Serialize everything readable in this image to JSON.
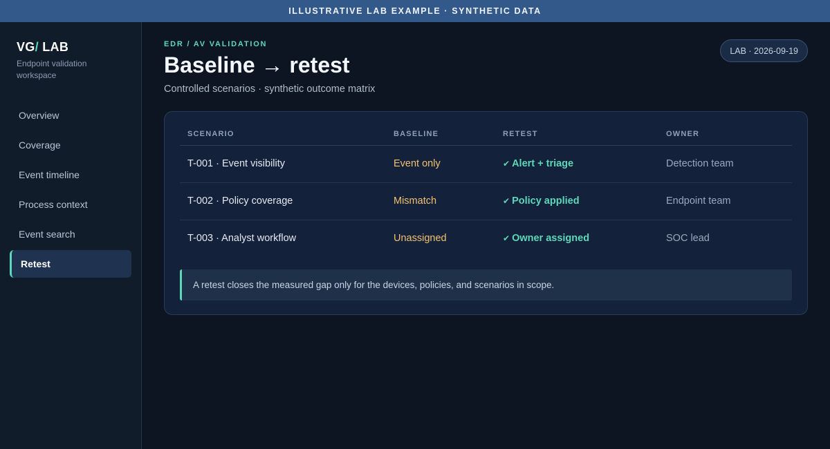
{
  "banner": {
    "text": "ILLUSTRATIVE LAB EXAMPLE · SYNTHETIC DATA"
  },
  "sidebar": {
    "brand_prefix": "VG",
    "brand_slash": "/",
    "brand_suffix": " LAB",
    "subtitle": "Endpoint validation workspace",
    "items": [
      {
        "label": "Overview",
        "active": false
      },
      {
        "label": "Coverage",
        "active": false
      },
      {
        "label": "Event timeline",
        "active": false
      },
      {
        "label": "Process context",
        "active": false
      },
      {
        "label": "Event search",
        "active": false
      },
      {
        "label": "Retest",
        "active": true
      }
    ]
  },
  "header": {
    "eyebrow": "EDR / AV VALIDATION",
    "title": "Baseline → retest",
    "subtitle": "Controlled scenarios · synthetic outcome matrix",
    "badge": "LAB · 2026-09-19"
  },
  "table": {
    "columns": [
      "SCENARIO",
      "BASELINE",
      "RETEST",
      "OWNER"
    ],
    "rows": [
      {
        "scenario": "T-001 · Event visibility",
        "baseline": "Event only",
        "retest": "Alert + triage",
        "owner": "Detection team"
      },
      {
        "scenario": "T-002 · Policy coverage",
        "baseline": "Mismatch",
        "retest": "Policy applied",
        "owner": "Endpoint team"
      },
      {
        "scenario": "T-003 · Analyst workflow",
        "baseline": "Unassigned",
        "retest": "Owner assigned",
        "owner": "SOC lead"
      }
    ]
  },
  "note": "A retest closes the measured gap only for the devices, policies, and scenarios in scope.",
  "colors": {
    "accent": "#5fd7b9",
    "baseline": "#f2c270",
    "banner": "#33598a",
    "background": "#0d1522"
  },
  "icons": {
    "retest_status": "check-icon"
  }
}
